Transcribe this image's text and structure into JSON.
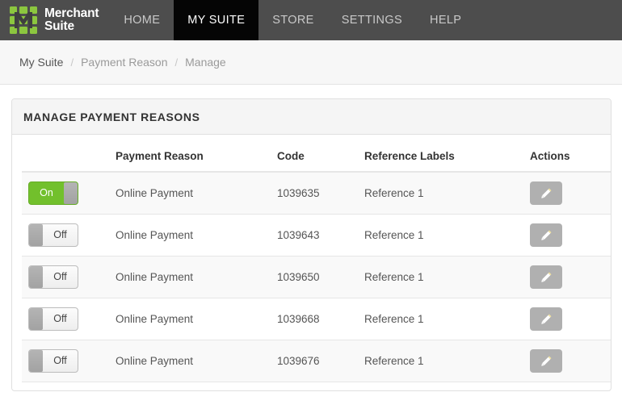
{
  "brand": {
    "line1": "Merchant",
    "line2": "Suite",
    "logo_icon": "merchant-suite-grid-m-logo",
    "logo_color": "#8cc63f"
  },
  "nav": {
    "items": [
      {
        "label": "HOME",
        "active": false
      },
      {
        "label": "MY SUITE",
        "active": true
      },
      {
        "label": "STORE",
        "active": false
      },
      {
        "label": "SETTINGS",
        "active": false
      },
      {
        "label": "HELP",
        "active": false
      }
    ]
  },
  "breadcrumb": {
    "separator": "/",
    "items": [
      {
        "label": "My Suite"
      },
      {
        "label": "Payment Reason"
      },
      {
        "label": "Manage"
      }
    ]
  },
  "panel": {
    "title": "MANAGE PAYMENT REASONS"
  },
  "table": {
    "headers": {
      "status": "",
      "reason": "Payment Reason",
      "code": "Code",
      "reference": "Reference Labels",
      "actions": "Actions"
    },
    "edit_icon": "pencil-icon",
    "rows": [
      {
        "status": "On",
        "status_state": "on",
        "reason": "Online Payment",
        "code": "1039635",
        "reference": "Reference 1"
      },
      {
        "status": "Off",
        "status_state": "off",
        "reason": "Online Payment",
        "code": "1039643",
        "reference": "Reference 1"
      },
      {
        "status": "Off",
        "status_state": "off",
        "reason": "Online Payment",
        "code": "1039650",
        "reference": "Reference 1"
      },
      {
        "status": "Off",
        "status_state": "off",
        "reason": "Online Payment",
        "code": "1039668",
        "reference": "Reference 1"
      },
      {
        "status": "Off",
        "status_state": "off",
        "reason": "Online Payment",
        "code": "1039676",
        "reference": "Reference 1"
      }
    ]
  },
  "colors": {
    "navbar": "#4d4d4d",
    "nav_active": "#050505",
    "accent_green": "#72c02c",
    "panel_header": "#f5f5f5",
    "row_stripe": "#f9f9f9"
  }
}
